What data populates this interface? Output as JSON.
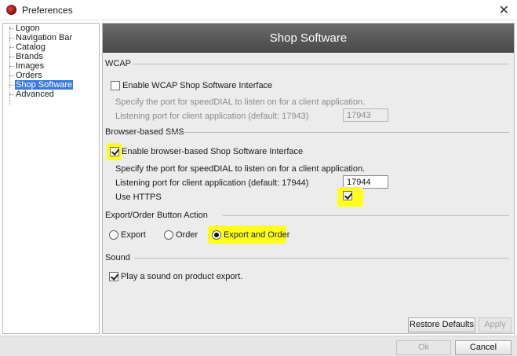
{
  "window": {
    "title": "Preferences",
    "close_glyph": "✕"
  },
  "nav": {
    "items": [
      {
        "label": "Logon",
        "selected": false
      },
      {
        "label": "Navigation Bar",
        "selected": false
      },
      {
        "label": "Catalog",
        "selected": false
      },
      {
        "label": "Brands",
        "selected": false
      },
      {
        "label": "Images",
        "selected": false
      },
      {
        "label": "Orders",
        "selected": false
      },
      {
        "label": "Shop Software",
        "selected": true
      },
      {
        "label": "Advanced",
        "selected": false
      }
    ]
  },
  "panel": {
    "title": "Shop Software",
    "wcap": {
      "section_title": "WCAP",
      "enable_label": "Enable WCAP Shop Software Interface",
      "enable_checked": false,
      "description": "Specify the port for speedDIAL to listen on for a client application.",
      "port_label": "Listening port for client application (default: 17943)",
      "port_value": "17943"
    },
    "browser_sms": {
      "section_title": "Browser-based SMS",
      "enable_label": "Enable browser-based Shop Software Interface",
      "enable_checked": true,
      "description": "Specify the port for speedDIAL to listen on for a client application.",
      "port_label": "Listening port for client application (default: 17944)",
      "port_value": "17944",
      "https_label": "Use HTTPS",
      "https_checked": true
    },
    "export_order": {
      "section_title": "Export/Order Button Action",
      "options": [
        "Export",
        "Order",
        "Export and Order"
      ],
      "selected": "Export and Order"
    },
    "sound": {
      "section_title": "Sound",
      "play_label": "Play a sound on product export.",
      "play_checked": true
    },
    "restore_defaults_label": "Restore Defaults",
    "apply_label": "Apply"
  },
  "footer": {
    "ok_label": "Ok",
    "cancel_label": "Cancel"
  },
  "colors": {
    "highlight": "#ffff1a",
    "selection": "#3b79d8",
    "header": "#5a5a5a"
  }
}
